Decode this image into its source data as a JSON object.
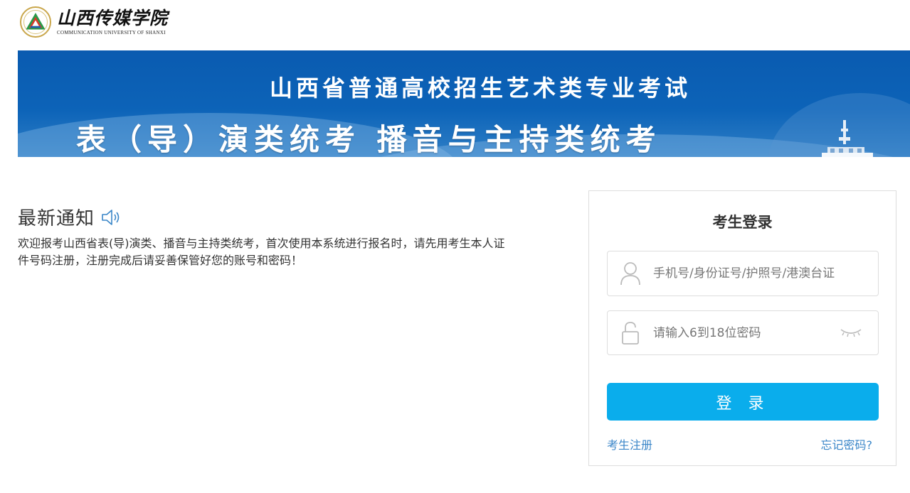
{
  "header": {
    "logo_cn": "山西传媒学院",
    "logo_en": "COMMUNICATION UNIVERSITY OF SHANXI",
    "emblem_icon": "university-emblem-icon"
  },
  "banner": {
    "title_line1": "山西省普通高校招生艺术类专业考试",
    "title_line2": "表（导）演类统考  播音与主持类统考",
    "background_color": "#0a5bb0"
  },
  "notice": {
    "title": "最新通知",
    "icon": "speaker-icon",
    "body": "欢迎报考山西省表(导)演类、播音与主持类统考，首次使用本系统进行报名时，请先用考生本人证件号码注册，注册完成后请妥善保管好您的账号和密码！"
  },
  "login": {
    "title": "考生登录",
    "username_placeholder": "手机号/身份证号/护照号/港澳台证",
    "username_icon": "user-icon",
    "password_placeholder": "请输入6到18位密码",
    "password_icon": "lock-icon",
    "toggle_icon": "eye-closed-icon",
    "submit_label": "登 录",
    "register_link": "考生注册",
    "forgot_link": "忘记密码?",
    "accent_color": "#0aadec",
    "link_color": "#3a86c8"
  }
}
